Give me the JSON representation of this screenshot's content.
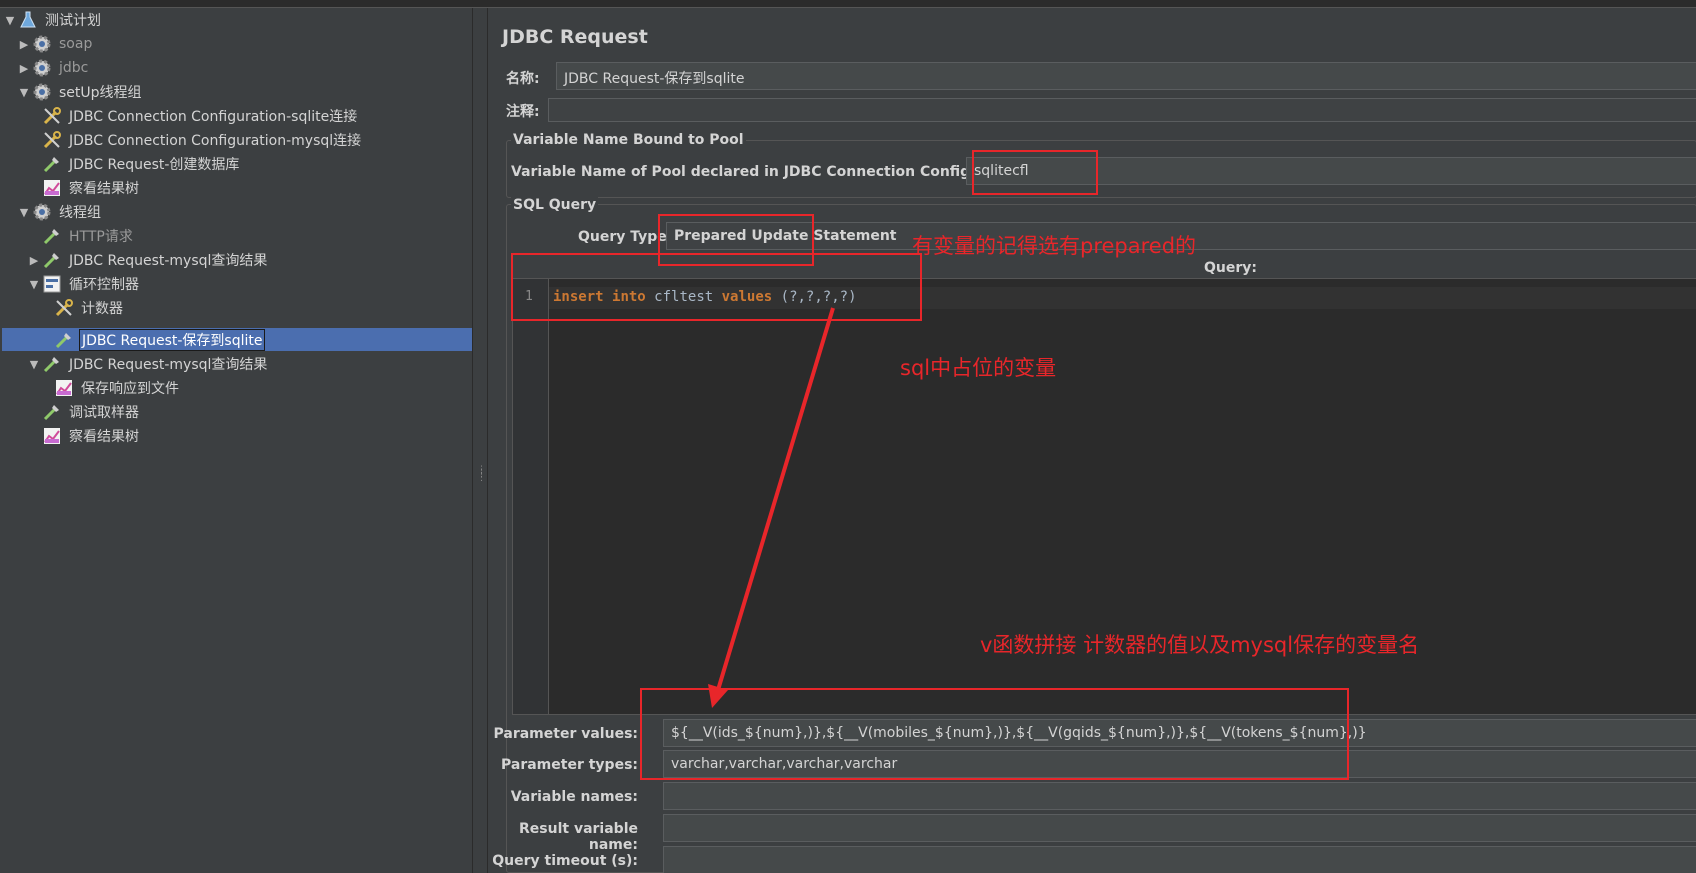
{
  "tree": {
    "items": [
      {
        "label": "测试计划",
        "icon": "flask-icon",
        "arrow": "▼"
      },
      {
        "label": "soap",
        "icon": "gear-icon",
        "arrow": "▶"
      },
      {
        "label": "jdbc",
        "icon": "gear-icon",
        "arrow": "▶"
      },
      {
        "label": "setUp线程组",
        "icon": "gear-icon",
        "arrow": "▼"
      },
      {
        "label": "JDBC Connection Configuration-sqlite连接",
        "icon": "wrench-icon",
        "arrow": ""
      },
      {
        "label": "JDBC Connection Configuration-mysql连接",
        "icon": "wrench-icon",
        "arrow": ""
      },
      {
        "label": "JDBC Request-创建数据库",
        "icon": "pipette-icon",
        "arrow": ""
      },
      {
        "label": "察看结果树",
        "icon": "chart-icon",
        "arrow": ""
      },
      {
        "label": "线程组",
        "icon": "gear-icon",
        "arrow": "▼"
      },
      {
        "label": "HTTP请求",
        "icon": "pipette-icon",
        "arrow": ""
      },
      {
        "label": "JDBC Request-mysql查询结果",
        "icon": "pipette-icon",
        "arrow": "▶"
      },
      {
        "label": "循环控制器",
        "icon": "loop-icon",
        "arrow": "▼"
      },
      {
        "label": "计数器",
        "icon": "wrench-icon",
        "arrow": ""
      },
      {
        "label": "JDBC Request-保存到sqlite",
        "icon": "pipette-icon",
        "arrow": ""
      },
      {
        "label": "JDBC Request-mysql查询结果",
        "icon": "pipette-icon",
        "arrow": "▼"
      },
      {
        "label": "保存响应到文件",
        "icon": "chart-icon",
        "arrow": ""
      },
      {
        "label": "调试取样器",
        "icon": "pipette-icon",
        "arrow": ""
      },
      {
        "label": "察看结果树",
        "icon": "chart-icon",
        "arrow": ""
      }
    ]
  },
  "main": {
    "title": "JDBC Request",
    "name_label": "名称:",
    "name_value": "JDBC Request-保存到sqlite",
    "comment_label": "注释:",
    "comment_value": "",
    "pool_group_title": "Variable Name Bound to Pool",
    "pool_label": "Variable Name of Pool declared in JDBC Connection Configuration:",
    "pool_value": "sqlitecfl",
    "sql_group_title": "SQL Query",
    "query_type_label": "Query Type",
    "query_type_value": "Prepared Update Statement",
    "query_label": "Query:",
    "line_number": "1",
    "code": {
      "kw1": "insert",
      "kw2": "into",
      "table": "cfltest",
      "kw3": "values",
      "rest": "(?,?,?,?)"
    },
    "params": {
      "values_label": "Parameter values:",
      "values_value": "${__V(ids_${num},)},${__V(mobiles_${num},)},${__V(gqids_${num},)},${__V(tokens_${num},)}",
      "types_label": "Parameter types:",
      "types_value": "varchar,varchar,varchar,varchar",
      "varnames_label": "Variable names:",
      "varnames_value": "",
      "result_label": "Result variable name:",
      "result_value": "",
      "timeout_label": "Query timeout (s):",
      "timeout_value": ""
    }
  },
  "annotations": {
    "note1": "有变量的记得选有prepared的",
    "note2": "sql中占位的变量",
    "note3": "v函数拼接 计数器的值以及mysql保存的变量名",
    "color": "#e8262a"
  },
  "colors": {
    "selection": "#4b6eaf",
    "keyword": "#cc7832",
    "code_text": "#a9b7c6"
  }
}
